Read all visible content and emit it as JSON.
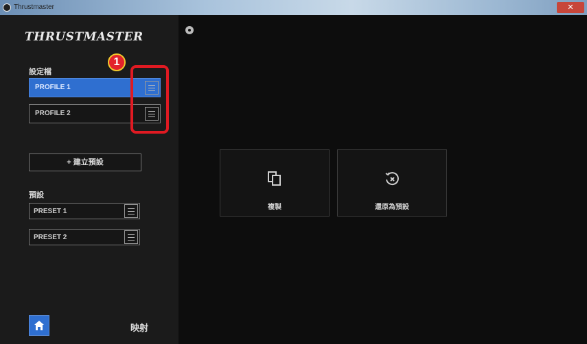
{
  "window": {
    "title": "Thrustmaster"
  },
  "brand": {
    "logo": "THRUSTMASTER"
  },
  "sidebar": {
    "profiles_label": "設定檔",
    "profiles": [
      {
        "label": "PROFILE 1",
        "active": true
      },
      {
        "label": "PROFILE 2",
        "active": false
      }
    ],
    "new_preset_label": "+ 建立預設",
    "presets_label": "預設",
    "presets": [
      {
        "label": "PRESET 1"
      },
      {
        "label": "PRESET 2"
      }
    ],
    "mapping_label": "映射"
  },
  "annotation": {
    "number": "1"
  },
  "main": {
    "tiles": [
      {
        "label": "複製",
        "icon": "copy-icon"
      },
      {
        "label": "還原為預設",
        "icon": "restore-icon"
      }
    ]
  },
  "colors": {
    "accent": "#2f6fd0",
    "highlight": "#e01a22"
  }
}
